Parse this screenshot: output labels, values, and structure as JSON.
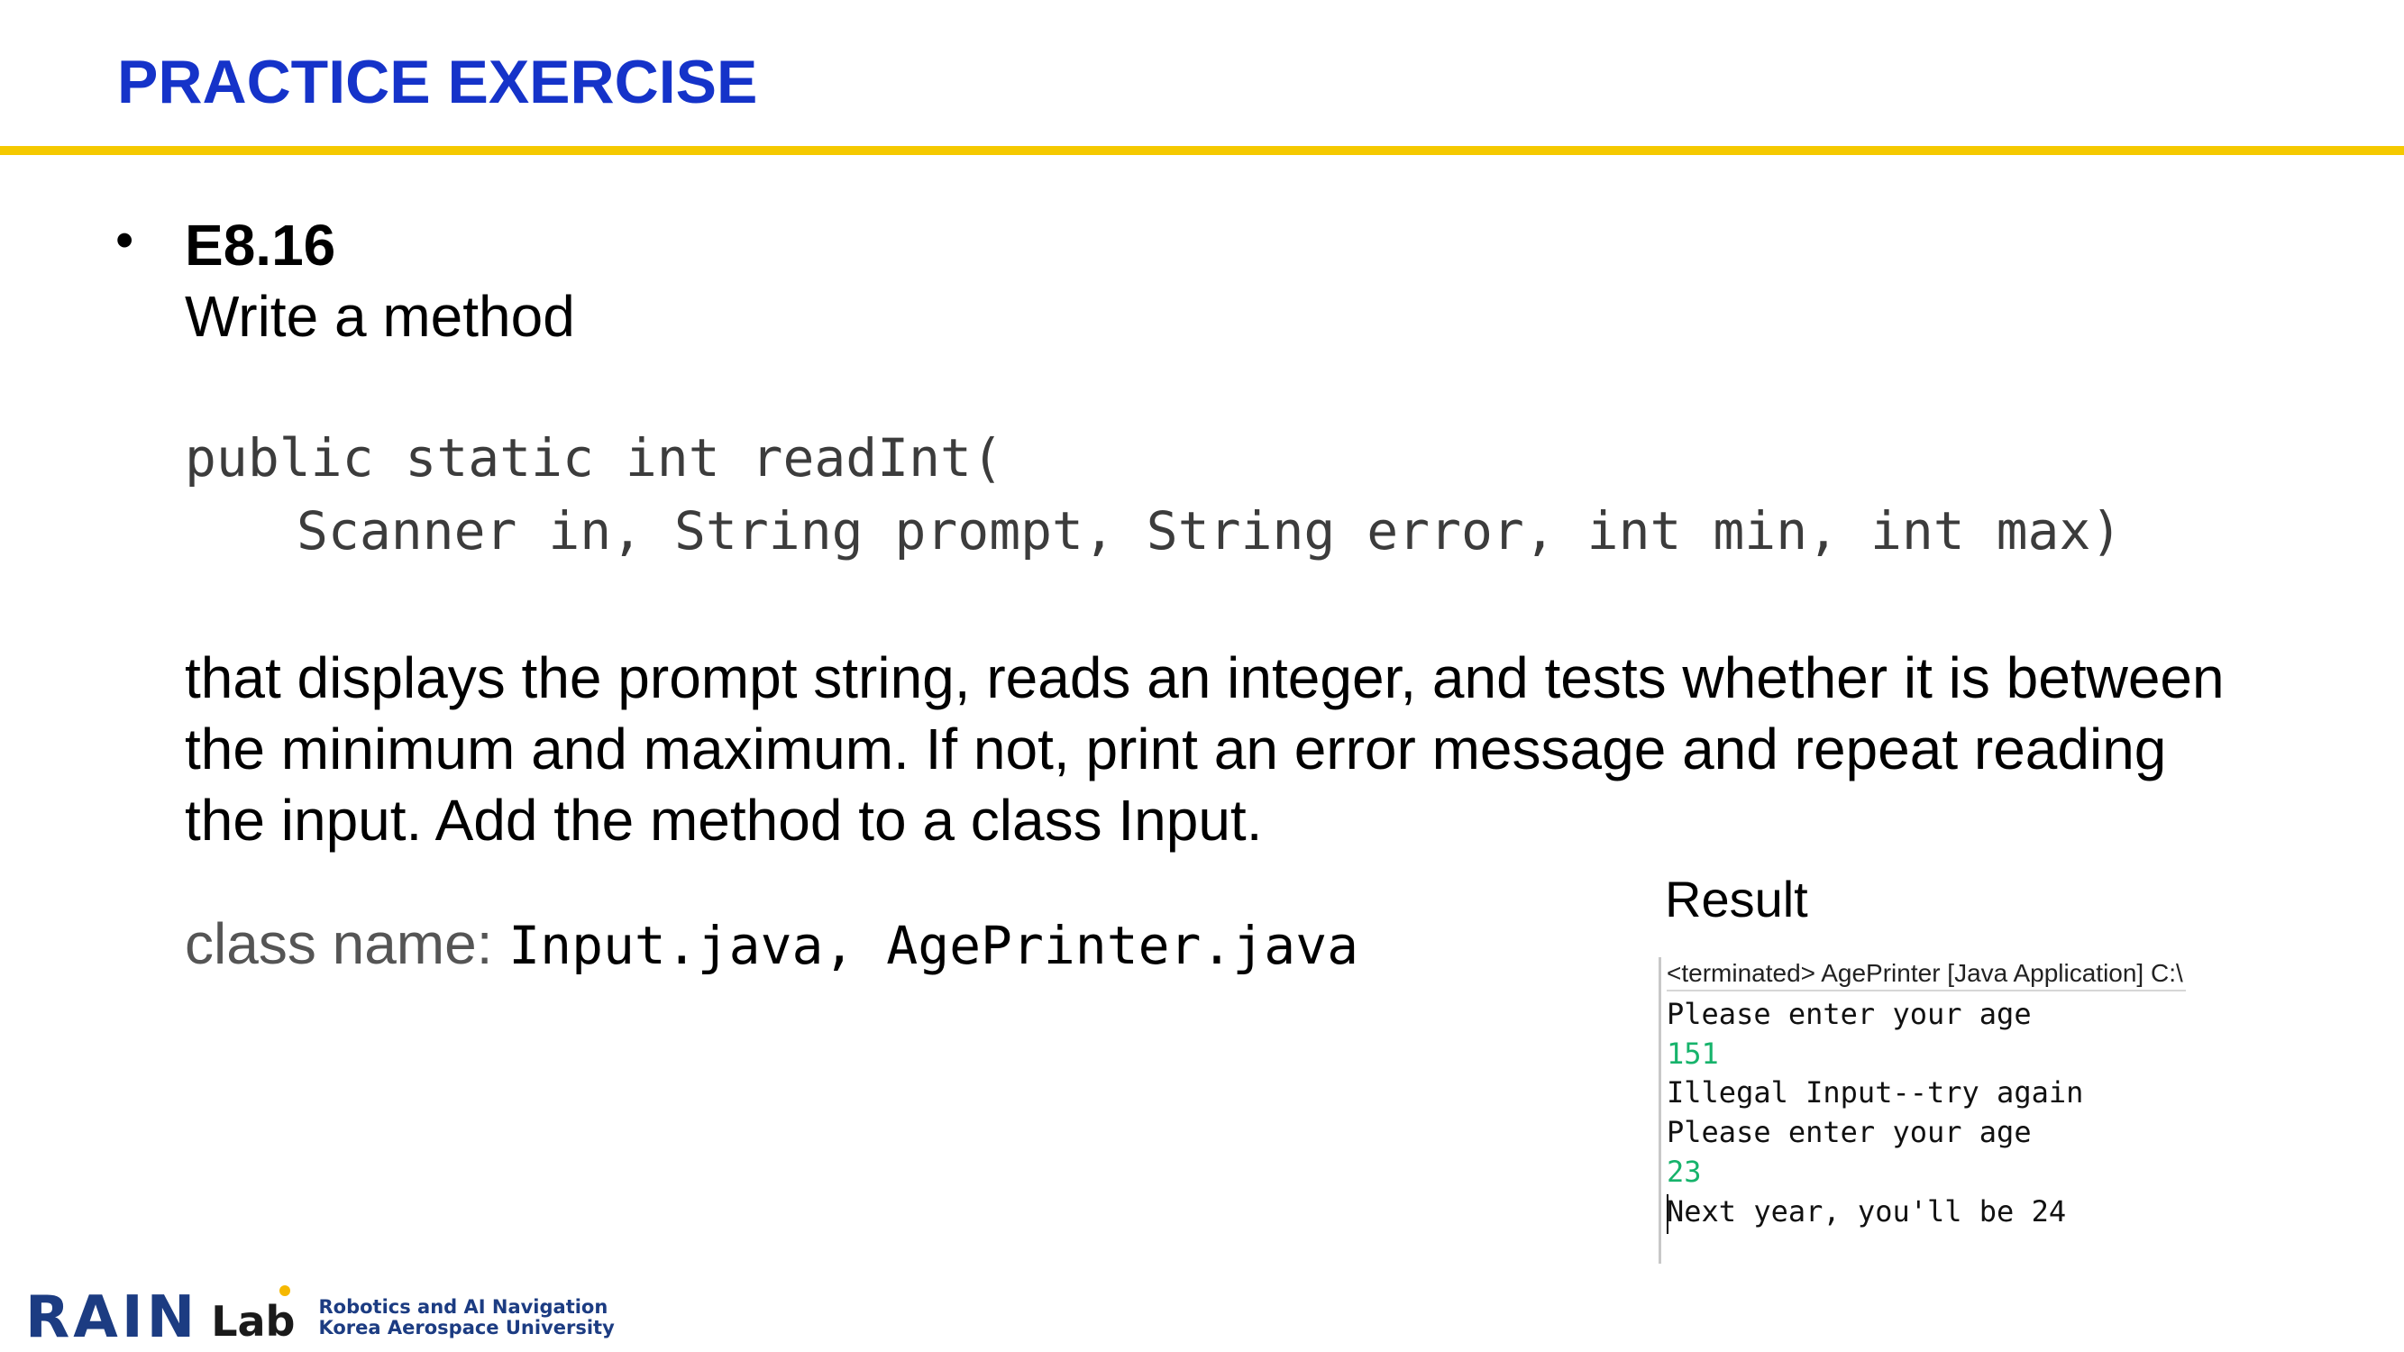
{
  "header": {
    "title": "PRACTICE EXERCISE",
    "rule_color": "#f5c900",
    "title_color": "#1533c9"
  },
  "exercise": {
    "bullet": "•",
    "id": "E8.16",
    "intro": "Write a method",
    "code_lines": [
      "public static int readInt(",
      "Scanner in, String prompt, String error, int min, int max)"
    ],
    "description": "that displays the prompt string, reads an integer, and tests whether it is between\nthe minimum and maximum. If not, print an error message and repeat reading\nthe input. Add the method to a class Input.",
    "classname_label": "class name: ",
    "classname_files": "Input.java, AgePrinter.java"
  },
  "result": {
    "label": "Result",
    "console_header": "<terminated> AgePrinter [Java Application] C:\\",
    "lines": [
      {
        "text": "Please enter your age",
        "kind": "output"
      },
      {
        "text": "151",
        "kind": "input"
      },
      {
        "text": "Illegal Input--try again",
        "kind": "output"
      },
      {
        "text": "Please enter your age",
        "kind": "output"
      },
      {
        "text": "23",
        "kind": "input"
      },
      {
        "text": "Next year, you'll be 24",
        "kind": "output"
      }
    ]
  },
  "footer": {
    "logo_main": "RAIN",
    "logo_sub": "Lab",
    "logo_line1": "Robotics and AI Navigation",
    "logo_line2": "Korea Aerospace University"
  }
}
